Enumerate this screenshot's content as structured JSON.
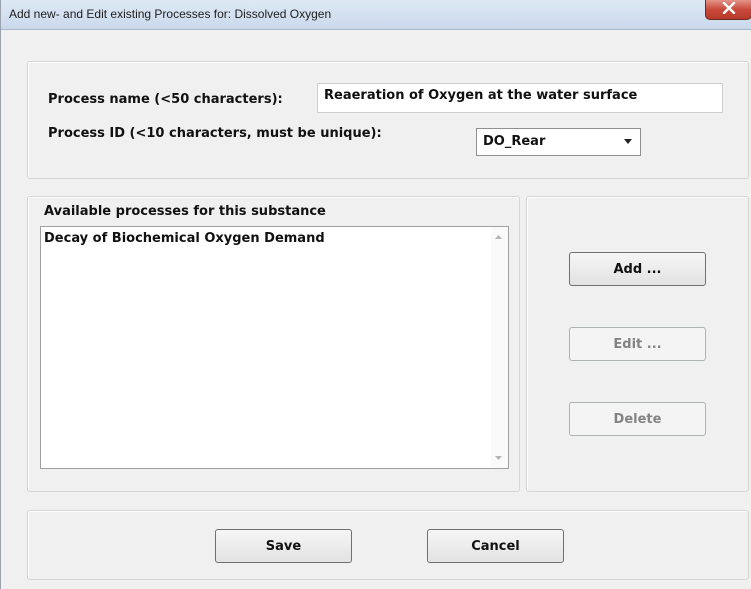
{
  "window": {
    "title": "Add new- and Edit existing Processes for: Dissolved Oxygen"
  },
  "process_name": {
    "label": "Process name (<50 characters):",
    "value": "Reaeration of Oxygen at the water surface"
  },
  "process_id": {
    "label": "Process ID (<10 characters, must be unique):",
    "value": "DO_Rear"
  },
  "available": {
    "header": "Available processes for this substance",
    "items": [
      "Decay of Biochemical Oxygen Demand"
    ]
  },
  "actions": {
    "add": "Add ...",
    "edit": "Edit ...",
    "delete": "Delete"
  },
  "footer": {
    "save": "Save",
    "cancel": "Cancel"
  }
}
